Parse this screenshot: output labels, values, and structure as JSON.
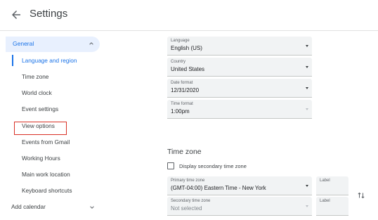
{
  "header": {
    "title": "Settings",
    "back_icon": "arrow-left-icon"
  },
  "sidebar": {
    "general": {
      "label": "General",
      "icon": "chevron-up-icon"
    },
    "items": [
      {
        "label": "Language and region",
        "active": true
      },
      {
        "label": "Time zone"
      },
      {
        "label": "World clock"
      },
      {
        "label": "Event settings"
      },
      {
        "label": "View options"
      },
      {
        "label": "Events from Gmail"
      },
      {
        "label": "Working Hours"
      },
      {
        "label": "Main work location"
      },
      {
        "label": "Keyboard shortcuts"
      }
    ],
    "add_calendar": {
      "label": "Add calendar",
      "icon": "chevron-down-icon"
    }
  },
  "main": {
    "language_region": {
      "language": {
        "label": "Language",
        "value": "English (US)"
      },
      "country": {
        "label": "Country",
        "value": "United States"
      },
      "date_format": {
        "label": "Date format",
        "value": "12/31/2020"
      },
      "time_format": {
        "label": "Time format",
        "value": "1:00pm"
      }
    },
    "time_zone": {
      "title": "Time zone",
      "secondary_checkbox_label": "Display secondary time zone",
      "primary": {
        "label": "Primary time zone",
        "value": "(GMT-04:00) Eastern Time - New York"
      },
      "primary_label_field": {
        "label": "Label"
      },
      "secondary": {
        "label": "Secondary time zone",
        "value": "Not selected"
      },
      "secondary_label_field": {
        "label": "Label"
      },
      "swap_icon": "swap-vertical-icon"
    }
  },
  "colors": {
    "accent": "#1a73e8",
    "highlight_bg": "#e8f0fe",
    "annotation_box": "#d93025",
    "field_bg": "#f1f3f4"
  }
}
